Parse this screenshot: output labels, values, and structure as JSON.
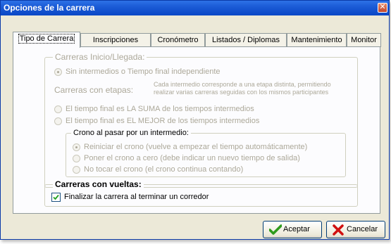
{
  "window": {
    "title": "Opciones de la carrera",
    "close_glyph": "✕"
  },
  "tabs": [
    {
      "label": "Tipo de Carrera",
      "active": true
    },
    {
      "label": "Inscripciones"
    },
    {
      "label": "Cronómetro"
    },
    {
      "label": "Listados / Diplomas"
    },
    {
      "label": "Mantenimiento"
    },
    {
      "label": "Monitor"
    }
  ],
  "group_inicio": {
    "legend": "Carreras Inicio/Llegada:",
    "radio_sin_intermedios": "Sin intermedios o Tiempo final independiente",
    "etapas_label": "Carreras con etapas:",
    "etapas_note_line1": "Cada intermedio corresponde a una etapa distinta, permitiendo",
    "etapas_note_line2": "realizar varias carreras seguidas con los mismos participantes",
    "radio_suma": "El tiempo final es LA SUMA de los tiempos intermedios",
    "radio_mejor": "El tiempo final es EL MEJOR de los tiempos intermedios"
  },
  "group_crono": {
    "legend": "Crono al pasar por un intermedio:",
    "radio_reiniciar": "Reiniciar el crono (vuelve a empezar el tiempo automáticamente)",
    "radio_cero": "Poner el crono a cero (debe indicar un nuevo tiempo de salida)",
    "radio_no_tocar": "No tocar el crono (el crono continua contando)"
  },
  "group_vueltas": {
    "legend": "Carreras con vueltas:",
    "checkbox_finalizar": "Finalizar la carrera al terminar un corredor"
  },
  "buttons": {
    "accept": "Aceptar",
    "cancel": "Cancelar"
  },
  "colors": {
    "titlebar": "#0a47c6",
    "disabled_text": "#aca899",
    "accept_icon": "#2e9b1c",
    "cancel_icon": "#d01010"
  }
}
